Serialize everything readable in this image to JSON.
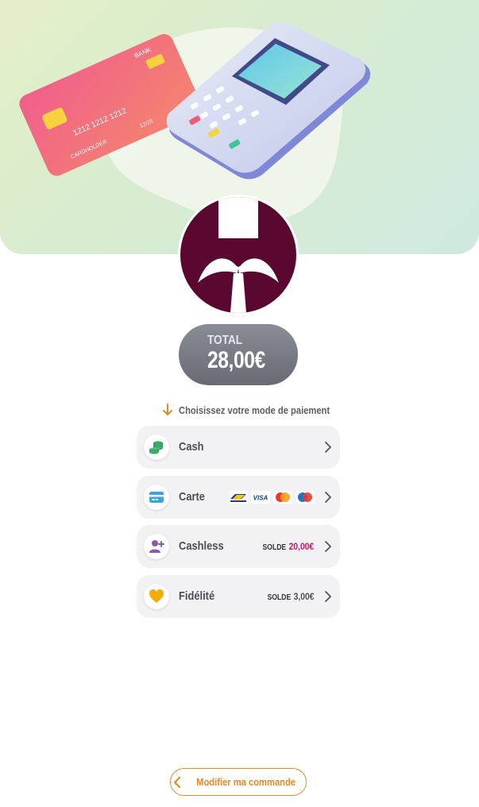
{
  "total": {
    "label": "TOTAL",
    "value": "28,00€"
  },
  "prompt": "Choisissez votre mode de paiement",
  "hero": {
    "card_text_bank": "BANK",
    "card_number": "1212  1212  1212",
    "card_holder": "CARDHOLDER",
    "card_expiry": "12/25"
  },
  "methods": [
    {
      "label": "Cash",
      "icon": "coins-icon"
    },
    {
      "label": "Carte",
      "icon": "credit-card-icon",
      "card_brands": [
        "Bancontact",
        "VISA",
        "Mastercard",
        "Maestro"
      ]
    },
    {
      "label": "Cashless",
      "icon": "user-add-icon",
      "solde_label": "SOLDE",
      "solde_value": "20,00€"
    },
    {
      "label": "Fidélité",
      "icon": "heart-icon",
      "solde_label": "SOLDE",
      "solde_value": "3,00€"
    }
  ],
  "modify_button": "Modifier ma commande",
  "colors": {
    "accent": "#e08a2b",
    "brand": "#5a0830",
    "cashless_solde": "#c0186f",
    "method_bg": "#f2f2f4"
  }
}
